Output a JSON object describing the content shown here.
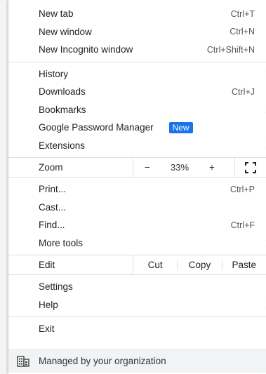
{
  "menu": {
    "items_top": [
      {
        "label": "New tab",
        "shortcut": "Ctrl+T"
      },
      {
        "label": "New window",
        "shortcut": "Ctrl+N"
      },
      {
        "label": "New Incognito window",
        "shortcut": "Ctrl+Shift+N"
      }
    ],
    "items_mid": [
      {
        "label": "History",
        "shortcut": ""
      },
      {
        "label": "Downloads",
        "shortcut": "Ctrl+J"
      },
      {
        "label": "Bookmarks",
        "shortcut": ""
      },
      {
        "label": "Google Password Manager",
        "badge": "New"
      },
      {
        "label": "Extensions",
        "shortcut": ""
      }
    ],
    "zoom": {
      "label": "Zoom",
      "minus": "−",
      "value": "33%",
      "plus": "+",
      "fullscreen_icon": "fullscreen-icon"
    },
    "items_print": [
      {
        "label": "Print...",
        "shortcut": "Ctrl+P"
      },
      {
        "label": "Cast...",
        "shortcut": ""
      },
      {
        "label": "Find...",
        "shortcut": "Ctrl+F"
      },
      {
        "label": "More tools",
        "shortcut": ""
      }
    ],
    "edit": {
      "label": "Edit",
      "cut": "Cut",
      "copy": "Copy",
      "paste": "Paste"
    },
    "items_settings": [
      {
        "label": "Settings"
      },
      {
        "label": "Help"
      }
    ],
    "exit": {
      "label": "Exit"
    },
    "managed": {
      "label": "Managed by your organization",
      "icon": "building-icon"
    }
  },
  "colors": {
    "badge": "#1a73e8",
    "managed_bg": "#f1f3f4"
  }
}
